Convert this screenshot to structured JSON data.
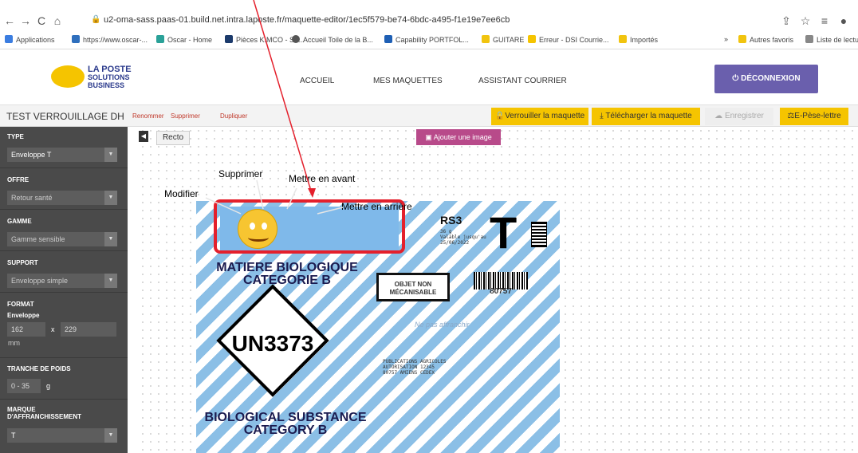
{
  "browser": {
    "url": "u2-oma-sass.paas-01.build.net.intra.laposte.fr/maquette-editor/1ec5f579-be74-6bdc-a495-f1e19e7ee6cb",
    "bookmarks": [
      "Applications",
      "https://www.oscar-...",
      "Oscar - Home",
      "Pièces K.MCO - Su...",
      "Accueil Toile de la B...",
      "Capability PORTFOL...",
      "GUITARE",
      "Erreur - DSI Courrie...",
      "Importés",
      "»",
      "Autres favoris",
      "Liste de lectu"
    ]
  },
  "header": {
    "logo_line1": "LA POSTE",
    "logo_line2": "SOLUTIONS",
    "logo_line3": "BUSINESS",
    "nav": [
      "ACCUEIL",
      "MES MAQUETTES",
      "ASSISTANT COURRIER"
    ],
    "logout": "DÉCONNEXION"
  },
  "editor": {
    "title": "TEST VERROUILLAGE DH",
    "links": [
      "Renommer",
      "Supprimer",
      "Dupliquer"
    ],
    "buttons": {
      "lock": "Verrouiller la maquette",
      "download": "Télécharger la maquette",
      "save": "Enregistrer",
      "scale": "E-Pèse-lettre"
    }
  },
  "sidebar": {
    "type_label": "TYPE",
    "type_value": "Enveloppe T",
    "offre_label": "OFFRE",
    "offre_value": "Retour santé",
    "gamme_label": "GAMME",
    "gamme_value": "Gamme sensible",
    "support_label": "SUPPORT",
    "support_value": "Enveloppe simple",
    "format_label": "FORMAT",
    "format_sub": "Enveloppe",
    "width": "162",
    "x": "x",
    "height": "229",
    "unit": "mm",
    "poids_label": "TRANCHE DE POIDS",
    "poids_value": "0 - 35",
    "poids_unit": "g",
    "marque_label1": "MARQUE",
    "marque_label2": "D'AFFRANCHISSEMENT",
    "marque_value": "T"
  },
  "canvas": {
    "tab": "Recto",
    "add_image": "Ajouter une image"
  },
  "envelope": {
    "rs3": "RS3",
    "small_lines": [
      "36 g",
      "Valable jusqu'au",
      "25/06/2022"
    ],
    "bigT": "T",
    "mat1": "MATIERE BIOLOGIQUE",
    "mat2": "CATEGORIE B",
    "objet1": "OBJET NON",
    "objet2": "MÉCANISABLE",
    "barcode_num": "80757",
    "un": "UN3373",
    "faded": "Ne pas affranchir",
    "pub": [
      "PUBLICATIONS AGRICOLES",
      "AUTORISATION 12345",
      "80757 AMIENS CEDEX"
    ],
    "bio1": "BIOLOGICAL SUBSTANCE",
    "bio2": "CATEGORY B"
  },
  "annotations": {
    "modifier": "Modifier",
    "supprimer": "Supprimer",
    "avant": "Mettre  en avant",
    "arriere": "Mettre en arrière"
  }
}
